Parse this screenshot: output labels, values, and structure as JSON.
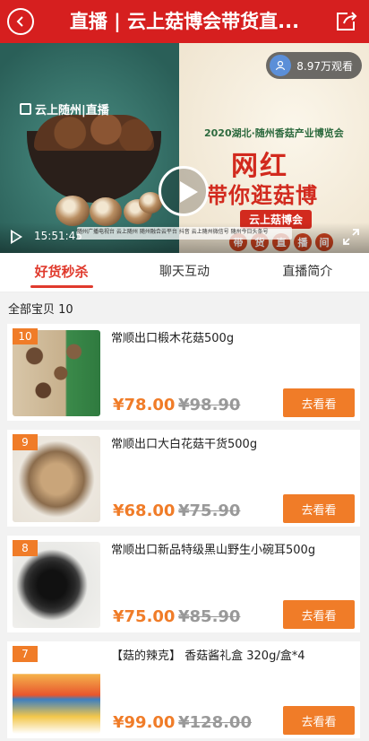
{
  "header": {
    "title": "直播 | 云上菇博会带货直...",
    "back_icon": "back-icon",
    "share_icon": "share-icon"
  },
  "video": {
    "logo_text": "云上随州|直播",
    "viewers": "8.97万观看",
    "expo_subtitle": "2020湖北·随州香菇产业博览会",
    "slogan_line1": "网红",
    "slogan_line2": "带你逛菇博",
    "fair_badge": "云上菇博会",
    "live_tags": [
      "带",
      "货",
      "直",
      "播",
      "间"
    ],
    "sponsors": "随州广播电视台  云上随州  随州融合云平台  抖音  云上随州微信号  随州今日头条号",
    "time": "15:51:45"
  },
  "tabs": [
    {
      "label": "好货秒杀",
      "active": true
    },
    {
      "label": "聊天互动",
      "active": false
    },
    {
      "label": "直播简介",
      "active": false
    }
  ],
  "list_count": "全部宝贝 10",
  "items": [
    {
      "rank": "10",
      "name": "常顺出口椴木花菇500g",
      "price": "¥78.00",
      "orig": "¥98.90",
      "btn": "去看看"
    },
    {
      "rank": "9",
      "name": "常顺出口大白花菇干货500g",
      "price": "¥68.00",
      "orig": "¥75.90",
      "btn": "去看看"
    },
    {
      "rank": "8",
      "name": "常顺出口新品特级黑山野生小碗耳500g",
      "price": "¥75.00",
      "orig": "¥85.90",
      "btn": "去看看"
    },
    {
      "rank": "7",
      "name": "【菇的辣克】 香菇酱礼盒 320g/盒*4",
      "price": "¥99.00",
      "orig": "¥128.00",
      "btn": "去看看"
    }
  ],
  "colors": {
    "header": "#d61f1f",
    "accent": "#f07c28",
    "tab_active": "#e03a2d"
  }
}
